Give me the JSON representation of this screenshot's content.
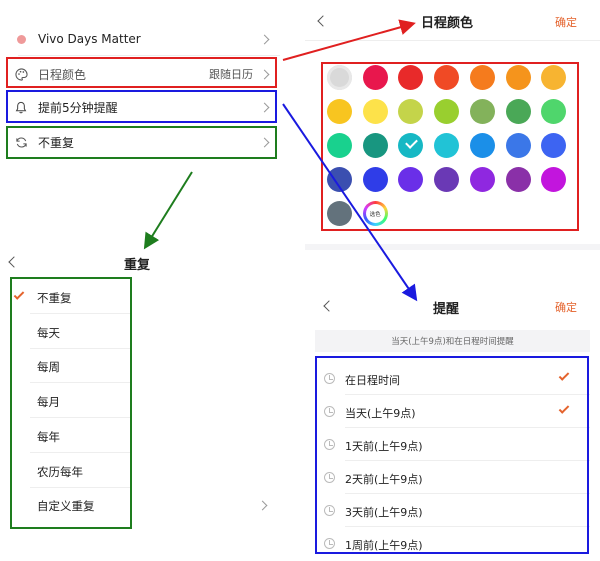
{
  "settings": {
    "event_name": "Vivo Days Matter",
    "color_label": "日程颜色",
    "color_value": "跟随日历",
    "reminder_label": "提前5分钟提醒",
    "repeat_label": "不重复"
  },
  "color_panel": {
    "title": "日程颜色",
    "confirm": "确定",
    "custom_label": "选色",
    "swatches": [
      "#d9d9d9",
      "#e8174d",
      "#e82a2a",
      "#f04a25",
      "#f57b1d",
      "#f5941c",
      "#f7b431",
      "#f8c520",
      "#fde24a",
      "#c4d44a",
      "#99cf2f",
      "#83b25b",
      "#4aa857",
      "#4fd66c",
      "#19d18e",
      "#189680",
      "#16b8c4",
      "#21c3d6",
      "#1b8fe8",
      "#3b77e8",
      "#3d64f2",
      "#3b4fb0",
      "#2f3de8",
      "#6a2fe8",
      "#6a39b5",
      "#8f28e0",
      "#8a30a8",
      "#c215dd",
      "#63727c"
    ],
    "selected_index": 16
  },
  "repeat_panel": {
    "title": "重复",
    "items": [
      "不重复",
      "每天",
      "每周",
      "每月",
      "每年",
      "农历每年",
      "自定义重复"
    ]
  },
  "remind_panel": {
    "title": "提醒",
    "confirm": "确定",
    "hint": "当天(上午9点)和在日程时间提醒",
    "items": [
      "在日程时间",
      "当天(上午9点)",
      "1天前(上午9点)",
      "2天前(上午9点)",
      "3天前(上午9点)",
      "1周前(上午9点)"
    ]
  }
}
